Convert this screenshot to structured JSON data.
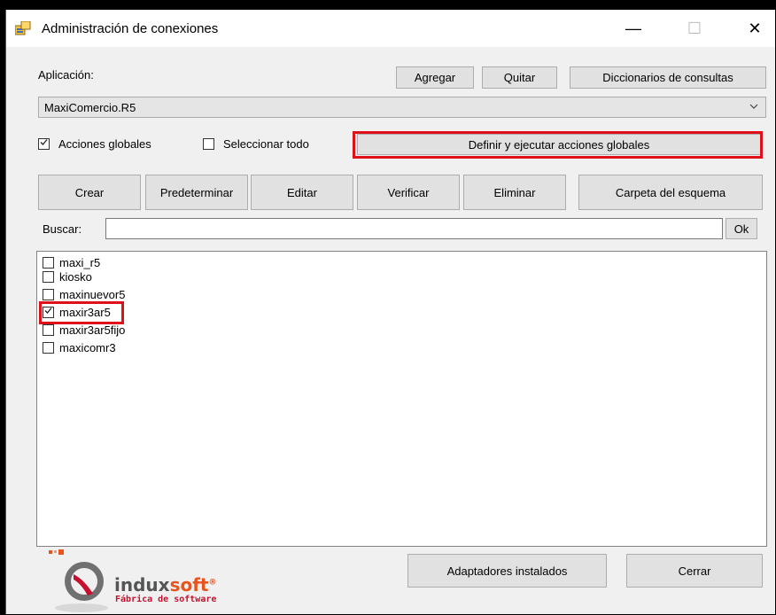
{
  "window": {
    "title": "Administración de conexiones",
    "minimize_glyph": "—",
    "maximize_glyph": "☐",
    "close_glyph": "✕"
  },
  "app_section": {
    "label": "Aplicación:",
    "buttons": {
      "add": "Agregar",
      "remove": "Quitar",
      "dictionaries": "Diccionarios de consultas"
    },
    "selected_app": "MaxiComercio.R5"
  },
  "options": {
    "global_actions": {
      "label": "Acciones globales",
      "checked": true
    },
    "select_all": {
      "label": "Seleccionar todo",
      "checked": false
    },
    "define_global_actions_button": "Definir y ejecutar acciones globales"
  },
  "toolbar": {
    "create": "Crear",
    "default": "Predeterminar",
    "edit": "Editar",
    "verify": "Verificar",
    "delete": "Eliminar",
    "schema_folder": "Carpeta del esquema"
  },
  "search": {
    "label": "Buscar:",
    "value": "",
    "ok": "Ok"
  },
  "connections": [
    {
      "name": "maxi_r5",
      "checked": false
    },
    {
      "name": "kiosko",
      "checked": false
    },
    {
      "name": "maxinuevor5",
      "checked": false
    },
    {
      "name": "maxir3ar5",
      "checked": true
    },
    {
      "name": "maxir3ar5fijo",
      "checked": false
    },
    {
      "name": "maxicomr3",
      "checked": false
    }
  ],
  "footer": {
    "adapters_button": "Adaptadores instalados",
    "close_button": "Cerrar",
    "logo_name_main": "indux",
    "logo_name_accent": "soft",
    "logo_registered": "®",
    "logo_tagline": "Fábrica de software"
  },
  "colors": {
    "highlight": "#e0101a",
    "button_bg": "#e1e1e1",
    "window_bg": "#f0f0f0",
    "logo_accent": "#e8541c"
  },
  "icons": {
    "app": "connections-window-icon",
    "dropdown": "chevron-down-icon",
    "check": "check-icon"
  }
}
